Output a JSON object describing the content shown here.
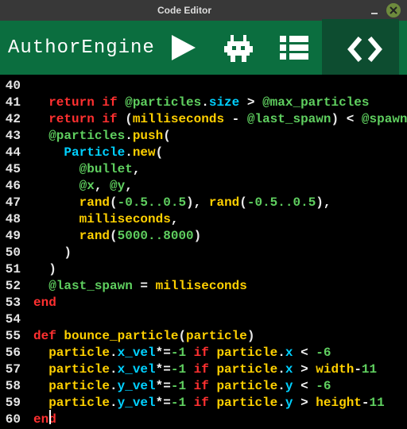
{
  "window": {
    "title": "Code Editor"
  },
  "app": {
    "brand": "AuthorEngine"
  },
  "colors": {
    "toolbar": "#0b6e3f",
    "toolbar_active": "#0d4d30",
    "bg": "#000000"
  },
  "toolbar": {
    "buttons": [
      {
        "name": "play-button",
        "icon": "play"
      },
      {
        "name": "sprite-editor-button",
        "icon": "robot"
      },
      {
        "name": "level-editor-button",
        "icon": "menu"
      },
      {
        "name": "code-editor-button",
        "icon": "code",
        "active": true
      }
    ]
  },
  "editor": {
    "first_line": 40,
    "cursor_line": 60,
    "lines": [
      {
        "n": 40,
        "tokens": []
      },
      {
        "n": 41,
        "tokens": [
          {
            "c": "kw",
            "t": "  return if "
          },
          {
            "c": "iv",
            "t": "@particles"
          },
          {
            "c": "op",
            "t": "."
          },
          {
            "c": "meth",
            "t": "size"
          },
          {
            "c": "op",
            "t": " > "
          },
          {
            "c": "iv",
            "t": "@max_particles"
          }
        ]
      },
      {
        "n": 42,
        "tokens": [
          {
            "c": "kw",
            "t": "  return if "
          },
          {
            "c": "par",
            "t": "("
          },
          {
            "c": "id",
            "t": "milliseconds"
          },
          {
            "c": "op",
            "t": " - "
          },
          {
            "c": "iv",
            "t": "@last_spawn"
          },
          {
            "c": "par",
            "t": ")"
          },
          {
            "c": "op",
            "t": " < "
          },
          {
            "c": "iv",
            "t": "@spawn_int"
          }
        ]
      },
      {
        "n": 43,
        "tokens": [
          {
            "c": "op",
            "t": "  "
          },
          {
            "c": "iv",
            "t": "@particles"
          },
          {
            "c": "op",
            "t": "."
          },
          {
            "c": "id",
            "t": "push"
          },
          {
            "c": "par",
            "t": "("
          }
        ]
      },
      {
        "n": 44,
        "tokens": [
          {
            "c": "op",
            "t": "    "
          },
          {
            "c": "meth",
            "t": "Particle"
          },
          {
            "c": "op",
            "t": "."
          },
          {
            "c": "id",
            "t": "new"
          },
          {
            "c": "par",
            "t": "("
          }
        ]
      },
      {
        "n": 45,
        "tokens": [
          {
            "c": "op",
            "t": "      "
          },
          {
            "c": "iv",
            "t": "@bullet"
          },
          {
            "c": "op",
            "t": ","
          }
        ]
      },
      {
        "n": 46,
        "tokens": [
          {
            "c": "op",
            "t": "      "
          },
          {
            "c": "iv",
            "t": "@x"
          },
          {
            "c": "op",
            "t": ", "
          },
          {
            "c": "iv",
            "t": "@y"
          },
          {
            "c": "op",
            "t": ","
          }
        ]
      },
      {
        "n": 47,
        "tokens": [
          {
            "c": "op",
            "t": "      "
          },
          {
            "c": "id",
            "t": "rand"
          },
          {
            "c": "par",
            "t": "("
          },
          {
            "c": "num",
            "t": "-0.5..0.5"
          },
          {
            "c": "par",
            "t": ")"
          },
          {
            "c": "op",
            "t": ", "
          },
          {
            "c": "id",
            "t": "rand"
          },
          {
            "c": "par",
            "t": "("
          },
          {
            "c": "num",
            "t": "-0.5..0.5"
          },
          {
            "c": "par",
            "t": ")"
          },
          {
            "c": "op",
            "t": ","
          }
        ]
      },
      {
        "n": 48,
        "tokens": [
          {
            "c": "op",
            "t": "      "
          },
          {
            "c": "id",
            "t": "milliseconds"
          },
          {
            "c": "op",
            "t": ","
          }
        ]
      },
      {
        "n": 49,
        "tokens": [
          {
            "c": "op",
            "t": "      "
          },
          {
            "c": "id",
            "t": "rand"
          },
          {
            "c": "par",
            "t": "("
          },
          {
            "c": "num",
            "t": "5000..8000"
          },
          {
            "c": "par",
            "t": ")"
          }
        ]
      },
      {
        "n": 50,
        "tokens": [
          {
            "c": "par",
            "t": "    )"
          }
        ]
      },
      {
        "n": 51,
        "tokens": [
          {
            "c": "par",
            "t": "  )"
          }
        ]
      },
      {
        "n": 52,
        "tokens": [
          {
            "c": "op",
            "t": "  "
          },
          {
            "c": "iv",
            "t": "@last_spawn"
          },
          {
            "c": "op",
            "t": " = "
          },
          {
            "c": "id",
            "t": "milliseconds"
          }
        ]
      },
      {
        "n": 53,
        "tokens": [
          {
            "c": "kw",
            "t": "end"
          }
        ]
      },
      {
        "n": 54,
        "tokens": []
      },
      {
        "n": 55,
        "tokens": [
          {
            "c": "kw",
            "t": "def "
          },
          {
            "c": "id",
            "t": "bounce_particle"
          },
          {
            "c": "par",
            "t": "("
          },
          {
            "c": "id",
            "t": "particle"
          },
          {
            "c": "par",
            "t": ")"
          }
        ]
      },
      {
        "n": 56,
        "tokens": [
          {
            "c": "op",
            "t": "  "
          },
          {
            "c": "id",
            "t": "particle"
          },
          {
            "c": "op",
            "t": "."
          },
          {
            "c": "meth",
            "t": "x_vel"
          },
          {
            "c": "op",
            "t": "*="
          },
          {
            "c": "num",
            "t": "-1"
          },
          {
            "c": "kw",
            "t": " if "
          },
          {
            "c": "id",
            "t": "particle"
          },
          {
            "c": "op",
            "t": "."
          },
          {
            "c": "meth",
            "t": "x"
          },
          {
            "c": "op",
            "t": " < "
          },
          {
            "c": "num",
            "t": "-6"
          }
        ]
      },
      {
        "n": 57,
        "tokens": [
          {
            "c": "op",
            "t": "  "
          },
          {
            "c": "id",
            "t": "particle"
          },
          {
            "c": "op",
            "t": "."
          },
          {
            "c": "meth",
            "t": "x_vel"
          },
          {
            "c": "op",
            "t": "*="
          },
          {
            "c": "num",
            "t": "-1"
          },
          {
            "c": "kw",
            "t": " if "
          },
          {
            "c": "id",
            "t": "particle"
          },
          {
            "c": "op",
            "t": "."
          },
          {
            "c": "meth",
            "t": "x"
          },
          {
            "c": "op",
            "t": " > "
          },
          {
            "c": "id",
            "t": "width"
          },
          {
            "c": "op",
            "t": "-"
          },
          {
            "c": "num",
            "t": "11"
          }
        ]
      },
      {
        "n": 58,
        "tokens": [
          {
            "c": "op",
            "t": "  "
          },
          {
            "c": "id",
            "t": "particle"
          },
          {
            "c": "op",
            "t": "."
          },
          {
            "c": "meth",
            "t": "y_vel"
          },
          {
            "c": "op",
            "t": "*="
          },
          {
            "c": "num",
            "t": "-1"
          },
          {
            "c": "kw",
            "t": " if "
          },
          {
            "c": "id",
            "t": "particle"
          },
          {
            "c": "op",
            "t": "."
          },
          {
            "c": "meth",
            "t": "y"
          },
          {
            "c": "op",
            "t": " < "
          },
          {
            "c": "num",
            "t": "-6"
          }
        ]
      },
      {
        "n": 59,
        "tokens": [
          {
            "c": "op",
            "t": "  "
          },
          {
            "c": "id",
            "t": "particle"
          },
          {
            "c": "op",
            "t": "."
          },
          {
            "c": "meth",
            "t": "y_vel"
          },
          {
            "c": "op",
            "t": "*="
          },
          {
            "c": "num",
            "t": "-1"
          },
          {
            "c": "kw",
            "t": " if "
          },
          {
            "c": "id",
            "t": "particle"
          },
          {
            "c": "op",
            "t": "."
          },
          {
            "c": "meth",
            "t": "y"
          },
          {
            "c": "op",
            "t": " > "
          },
          {
            "c": "id",
            "t": "height"
          },
          {
            "c": "op",
            "t": "-"
          },
          {
            "c": "num",
            "t": "11"
          }
        ]
      },
      {
        "n": 60,
        "tokens": [
          {
            "c": "kw",
            "t": "end"
          }
        ]
      }
    ]
  }
}
